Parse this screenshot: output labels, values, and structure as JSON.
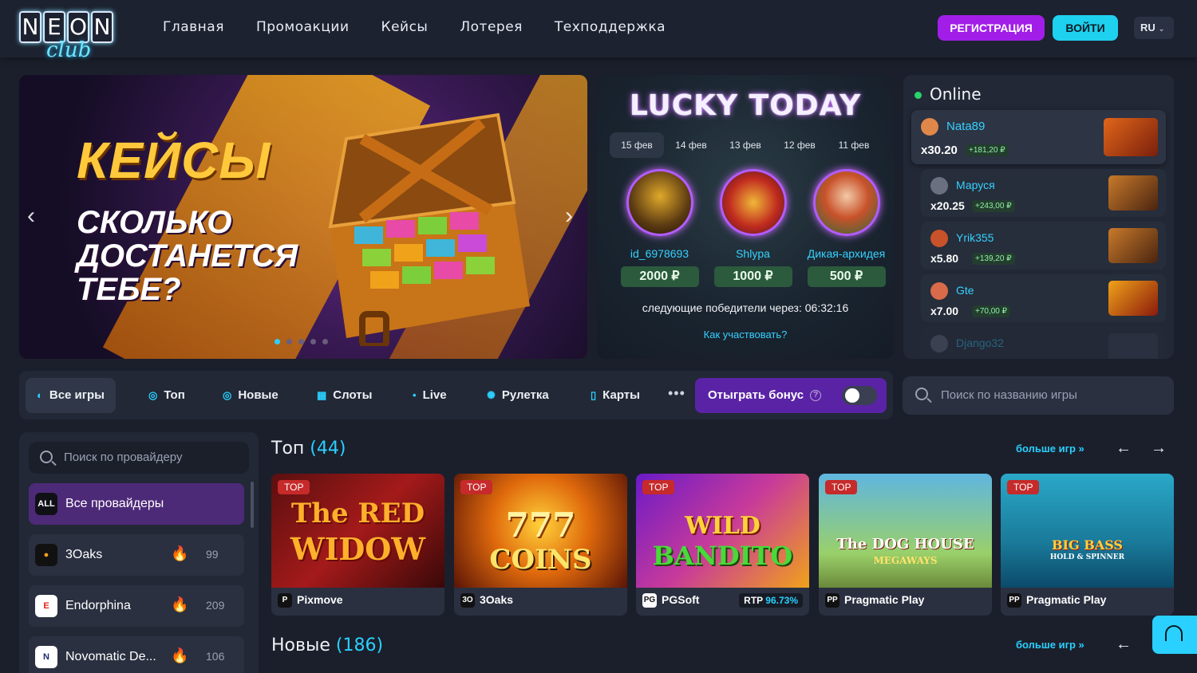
{
  "header": {
    "logo_letters": [
      "N",
      "E",
      "O",
      "N"
    ],
    "logo_sub": "club",
    "nav": [
      "Главная",
      "Промоакции",
      "Кейсы",
      "Лотерея",
      "Техподдержка"
    ],
    "register": "РЕГИСТРАЦИЯ",
    "login": "ВОЙТИ",
    "lang": "RU"
  },
  "banner": {
    "title": "КЕЙСЫ",
    "subtitle": "СКОЛЬКО ДОСТАНЕТСЯ ТЕБЕ?",
    "slides": 5,
    "active_slide": 1
  },
  "lucky": {
    "title": "LUCKY TODAY",
    "dates": [
      "15 фев",
      "14 фев",
      "13 фев",
      "12 фев",
      "11 фев"
    ],
    "winners": [
      {
        "name": "id_6978693",
        "prize": "2000 ₽"
      },
      {
        "name": "Shlypa",
        "prize": "1000 ₽"
      },
      {
        "name": "Дикая-архидея",
        "prize": "500 ₽"
      }
    ],
    "next": "следующие победители через: 06:32:16",
    "how": "Как участвовать?"
  },
  "online": {
    "title": "Online",
    "rows": [
      {
        "name": "Nata89",
        "mult": "x30.20",
        "win": "+181,20 ₽"
      },
      {
        "name": "Маруся",
        "mult": "x20.25",
        "win": "+243,00 ₽"
      },
      {
        "name": "Yrik355",
        "mult": "x5.80",
        "win": "+139,20 ₽"
      },
      {
        "name": "Gte",
        "mult": "x7.00",
        "win": "+70,00 ₽"
      },
      {
        "name": "Django32",
        "mult": "",
        "win": ""
      }
    ]
  },
  "filters": {
    "items": [
      "Все игры",
      "Топ",
      "Новые",
      "Слоты",
      "Live",
      "Рулетка",
      "Карты"
    ],
    "bonus": "Отыграть бонус",
    "search_placeholder": "Поиск по названию игры"
  },
  "providers": {
    "search_placeholder": "Поиск по провайдеру",
    "items": [
      {
        "logo": "ALL",
        "name": "Все провайдеры",
        "count": ""
      },
      {
        "logo": "3O",
        "name": "3Oaks",
        "count": "99"
      },
      {
        "logo": "E",
        "name": "Endorphina",
        "count": "209"
      },
      {
        "logo": "N",
        "name": "Novomatic De...",
        "count": "106"
      }
    ]
  },
  "top_section": {
    "title": "Топ",
    "count": "(44)",
    "more": "больше игр »",
    "games": [
      {
        "badge": "TOP",
        "art_line1": "The RED",
        "art_line2": "WIDOW",
        "provider_icon": "P",
        "provider": "Pixmove",
        "rtp_label": "",
        "rtp": ""
      },
      {
        "badge": "TOP",
        "art_line1": "777",
        "art_line2": "COINS",
        "provider_icon": "3O",
        "provider": "3Oaks",
        "rtp_label": "",
        "rtp": ""
      },
      {
        "badge": "TOP",
        "art_line1": "WILD",
        "art_line2": "BANDITO",
        "provider_icon": "PG",
        "provider": "PGSoft",
        "rtp_label": "RTP",
        "rtp": "96.73%"
      },
      {
        "badge": "TOP",
        "art_line1": "The DOG HOUSE",
        "art_line2": "MEGAWAYS",
        "provider_icon": "PP",
        "provider": "Pragmatic Play",
        "rtp_label": "",
        "rtp": ""
      },
      {
        "badge": "TOP",
        "art_line1": "BIG BASS",
        "art_line2": "HOLD & SPINNER",
        "provider_icon": "PP",
        "provider": "Pragmatic Play",
        "rtp_label": "",
        "rtp": ""
      }
    ]
  },
  "new_section": {
    "title": "Новые",
    "count": "(186)",
    "more": "больше игр »"
  },
  "colors": {
    "accent_cyan": "#2ad0ff",
    "accent_purple": "#a21ee8",
    "background": "#1b1f2b"
  }
}
